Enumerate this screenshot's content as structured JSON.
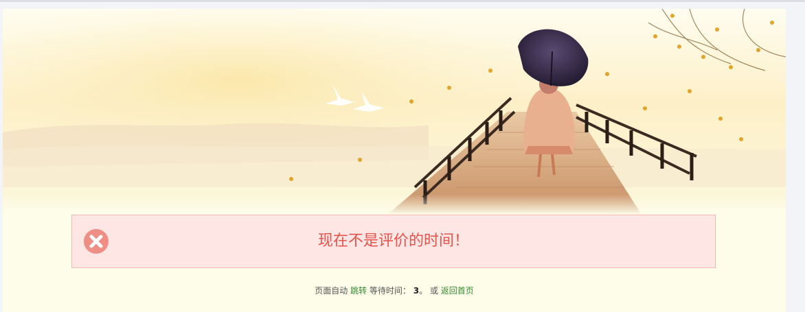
{
  "alert": {
    "message": "现在不是评价的时间！",
    "icon": "close-circle-icon",
    "accent_color": "#e5534b",
    "background_color": "#fde6e4"
  },
  "redirect": {
    "prefix": "页面自动",
    "jump_link": "跳转",
    "wait_label": "等待时间：",
    "countdown": "3",
    "period": "。",
    "or_text": "或",
    "home_link": "返回首页",
    "link_color": "#2f8b2f"
  }
}
